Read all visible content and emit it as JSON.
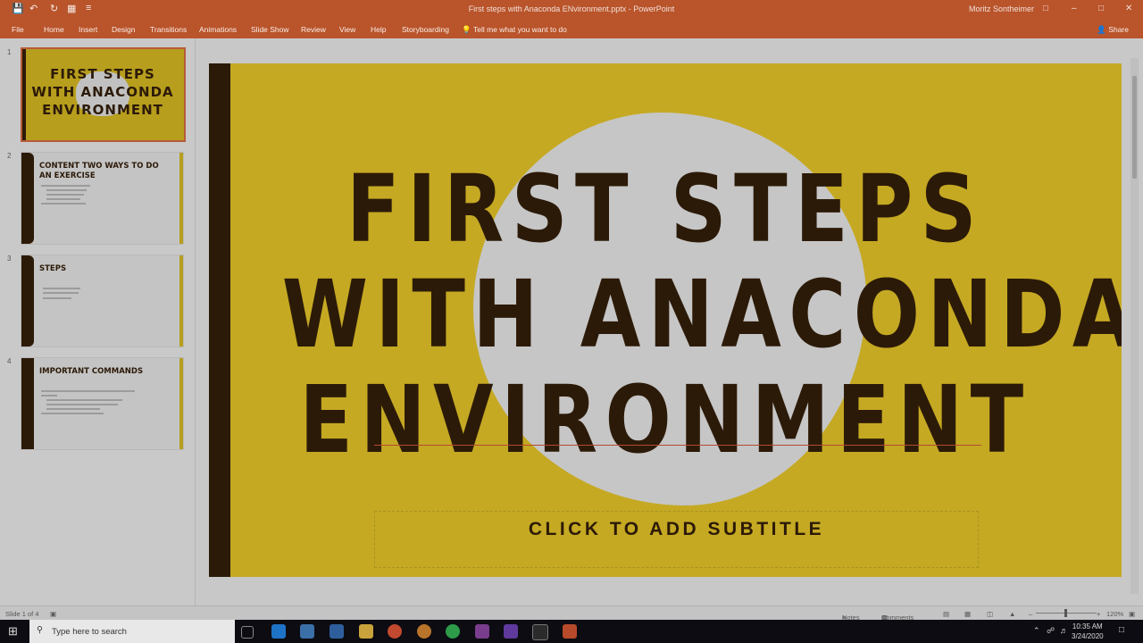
{
  "titlebar": {
    "document_title": "First steps with Anaconda ENvironment.pptx  -  PowerPoint",
    "user": "Moritz Sontheimer"
  },
  "ribbon": {
    "tabs": [
      "File",
      "Home",
      "Insert",
      "Design",
      "Transitions",
      "Animations",
      "Slide Show",
      "Review",
      "View",
      "Help",
      "Storyboarding"
    ],
    "tell_me": "Tell me what you want to do",
    "share": "Share"
  },
  "thumbnails": [
    {
      "number": "1",
      "title_lines": [
        "FIRST STEPS",
        "WITH ANACONDA",
        "ENVIRONMENT"
      ]
    },
    {
      "number": "2",
      "title": "CONTENT TWO WAYS TO DO AN EXERCISE"
    },
    {
      "number": "3",
      "title": "STEPS"
    },
    {
      "number": "4",
      "title": "IMPORTANT COMMANDS"
    }
  ],
  "slide": {
    "title_lines": [
      "FIRST STEPS",
      "WITH ANACONDA",
      "ENVIRONMENT"
    ],
    "subtitle_placeholder": "CLICK TO ADD SUBTITLE"
  },
  "statusbar": {
    "slide_counter": "Slide 1 of 4",
    "notes": "Notes",
    "comments": "Comments",
    "zoom": "120%"
  },
  "taskbar": {
    "search_placeholder": "Type here to search",
    "time": "10:35 AM",
    "date": "3/24/2020"
  },
  "colors": {
    "ribbon": "#b9542b",
    "slide_gold": "#c5a923",
    "slide_dark": "#2c1a08"
  }
}
